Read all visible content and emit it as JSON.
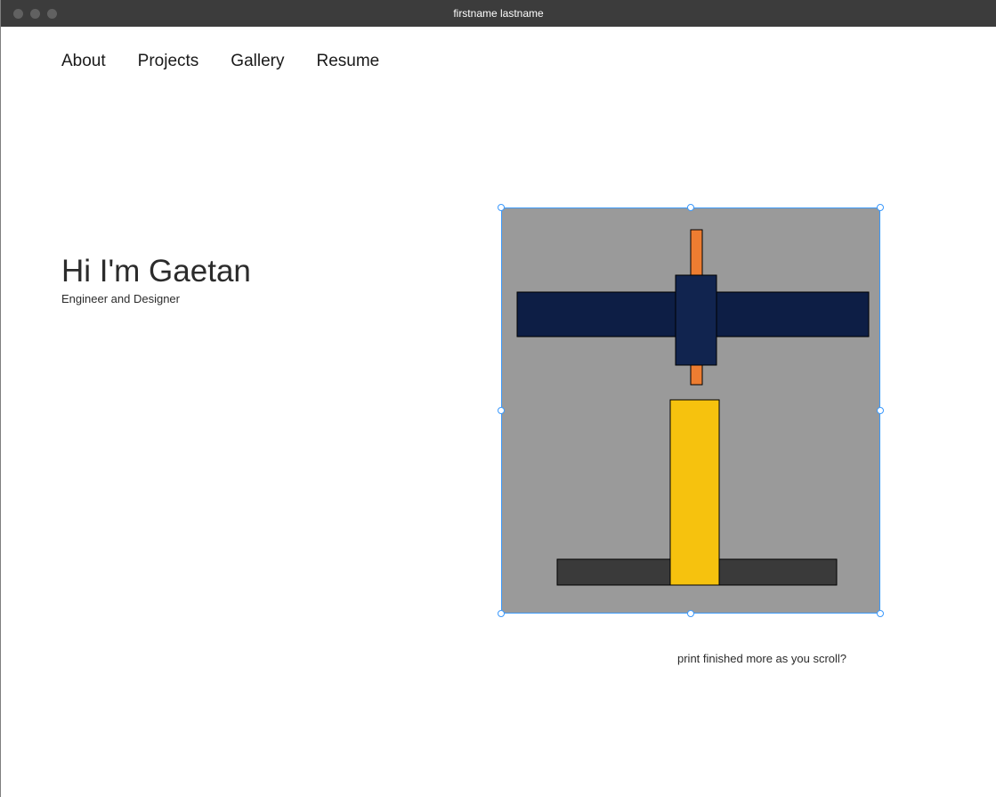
{
  "window": {
    "title": "firstname lastname"
  },
  "nav": {
    "about": "About",
    "projects": "Projects",
    "gallery": "Gallery",
    "resume": "Resume"
  },
  "hero": {
    "heading": "Hi I'm Gaetan",
    "subheading": "Engineer and Designer"
  },
  "caption": "print finished more as you scroll?",
  "colors": {
    "titlebar_bg": "#3c3c3c",
    "selection": "#3b99fc",
    "svg_bg": "#9a9a9a",
    "navy": "#0d1e45",
    "navy_mid": "#11244f",
    "yellow": "#f6c20e",
    "orange": "#ed7d31",
    "charcoal": "#3a3a3a"
  }
}
